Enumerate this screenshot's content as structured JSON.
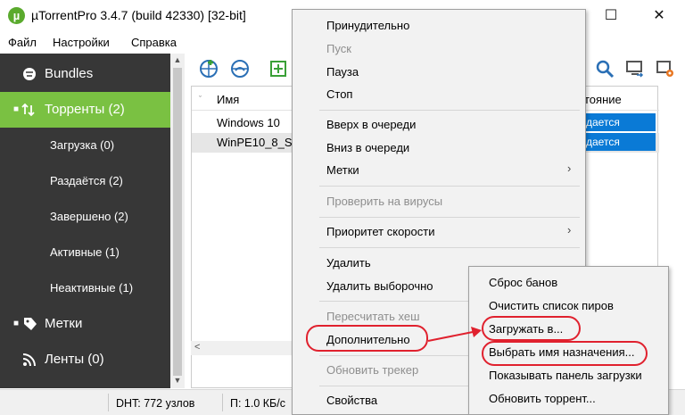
{
  "window": {
    "title": "µTorrentPro 3.4.7  (build 42330) [32-bit]",
    "logo_glyph": "µ",
    "minimize": "—",
    "maximize": "☐",
    "close": "✕"
  },
  "menubar": [
    "Файл",
    "Настройки",
    "Справка"
  ],
  "sidebar": {
    "items": [
      {
        "label": "Bundles",
        "icon": "bundles-icon"
      },
      {
        "label": "Торренты (2)",
        "icon": "torrents-icon"
      },
      {
        "label": "Загрузка (0)"
      },
      {
        "label": "Раздаётся (2)"
      },
      {
        "label": "Завершено (2)"
      },
      {
        "label": "Активные (1)"
      },
      {
        "label": "Неактивные (1)"
      },
      {
        "label": "Метки",
        "icon": "tag-icon"
      },
      {
        "label": "Ленты (0)",
        "icon": "rss-icon"
      }
    ]
  },
  "table": {
    "col_name": "Имя",
    "col_state": "тояние",
    "rows": [
      {
        "name": "Windows 10",
        "state": "дается"
      },
      {
        "name": "WinPE10_8_S",
        "state": "дается"
      }
    ]
  },
  "statusbar": {
    "dht": "DHT: 772 узлов",
    "download": "П: 1.0 КБ/с"
  },
  "context_menu": {
    "items": [
      {
        "label": "Принудительно",
        "disabled": false
      },
      {
        "label": "Пуск",
        "disabled": true
      },
      {
        "label": "Пауза",
        "disabled": false
      },
      {
        "label": "Стоп",
        "disabled": false
      },
      {
        "label": "Вверх в очереди",
        "disabled": false
      },
      {
        "label": "Вниз в очереди",
        "disabled": false
      },
      {
        "label": "Метки",
        "disabled": false,
        "submenu": true
      },
      {
        "label": "Проверить на вирусы",
        "disabled": true
      },
      {
        "label": "Приоритет скорости",
        "disabled": false,
        "submenu": true
      },
      {
        "label": "Удалить",
        "disabled": false
      },
      {
        "label": "Удалить выборочно",
        "disabled": false,
        "submenu": true
      },
      {
        "label": "Пересчитать хеш",
        "disabled": true
      },
      {
        "label": "Дополнительно",
        "disabled": false,
        "submenu": true
      },
      {
        "label": "Обновить трекер",
        "disabled": true
      },
      {
        "label": "Свойства",
        "disabled": false
      }
    ],
    "chevron": "›"
  },
  "submenu": {
    "items": [
      "Сброс банов",
      "Очистить список пиров",
      "Загружать в...",
      "Выбрать имя назначения...",
      "Показывать панель загрузки",
      "Обновить торрент..."
    ]
  },
  "colors": {
    "accent_green": "#7ac142",
    "sidebar_bg": "#373737",
    "selection_blue": "#0a7ad6",
    "annotation_red": "#e0212e"
  }
}
